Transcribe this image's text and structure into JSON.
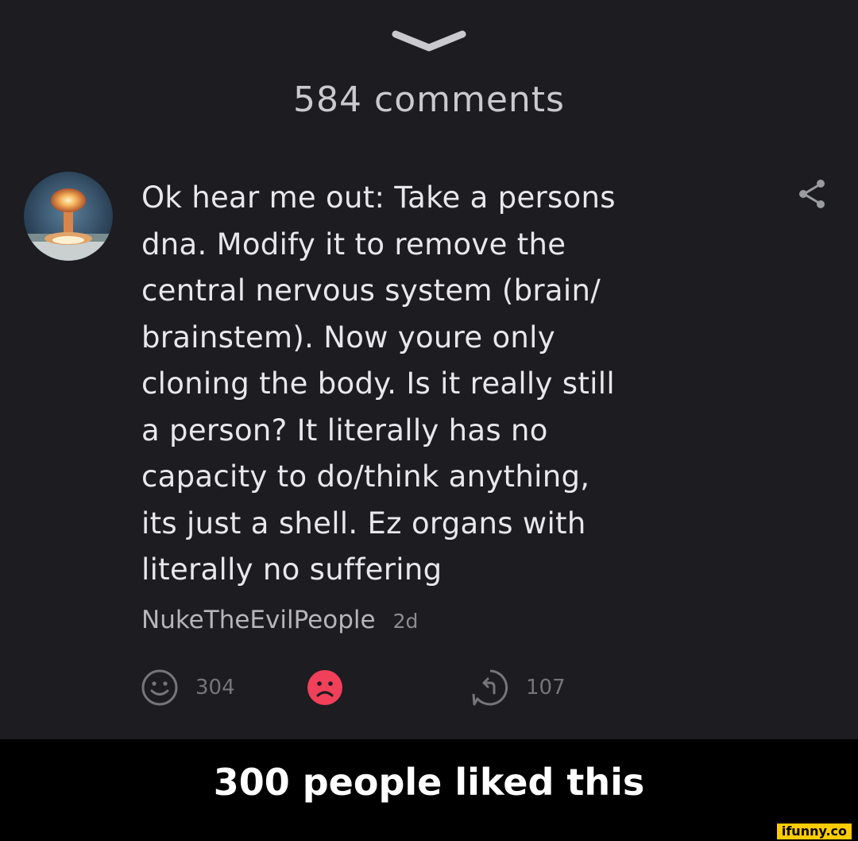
{
  "header": {
    "comments_count": "584 comments"
  },
  "comment": {
    "text": "Ok hear me out: Take a persons\ndna. Modify it to remove the\ncentral nervous system (brain/\nbrainstem). Now youre only\ncloning the body. Is it really still\na person? It literally has no\ncapacity to do/think anything,\nits just a shell. Ez organs with\nliterally no suffering",
    "author": "NukeTheEvilPeople",
    "age": "2d",
    "avatar_icon": "mushroom-cloud-avatar"
  },
  "actions": {
    "like_count": "304",
    "like_icon": "smile-icon",
    "dislike_icon": "frown-icon",
    "reply_icon": "reply-icon",
    "reply_count": "107"
  },
  "caption": "300 people liked this",
  "watermark": "ifunny.co",
  "colors": {
    "panel_background": "#1c1c21",
    "dislike_active": "#f0405a",
    "watermark_yellow": "#ffcc00"
  }
}
